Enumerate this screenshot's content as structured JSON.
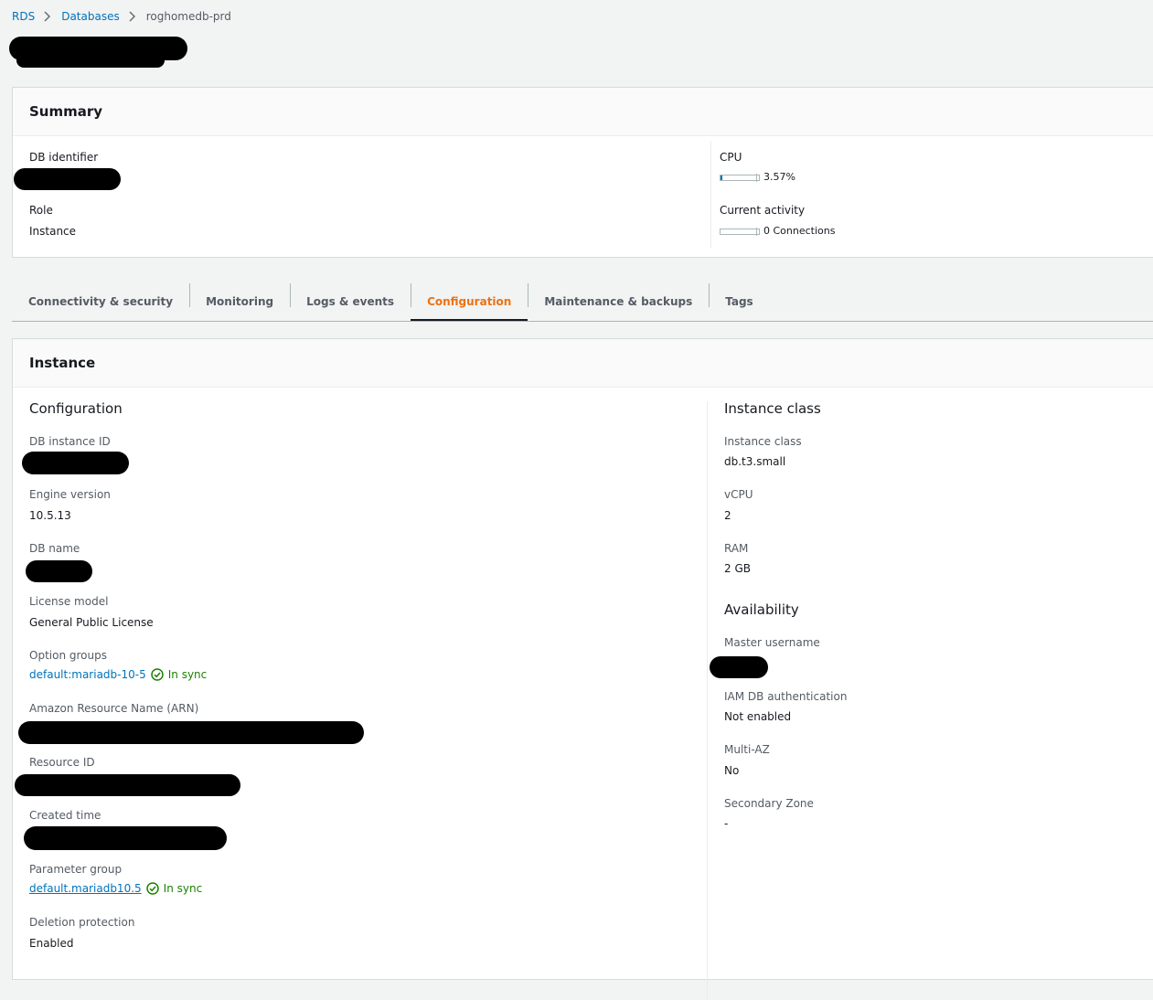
{
  "breadcrumb": {
    "items": [
      {
        "label": "RDS"
      },
      {
        "label": "Databases"
      }
    ],
    "current": "roghomedb-prd"
  },
  "summary": {
    "title": "Summary",
    "db_identifier_label": "DB identifier",
    "role_label": "Role",
    "role_value": "Instance",
    "cpu_label": "CPU",
    "cpu_value": "3.57%",
    "cpu_fraction": 0.0357,
    "activity_label": "Current activity",
    "activity_value": "0 Connections",
    "activity_fraction": 0
  },
  "tabs": [
    {
      "label": "Connectivity & security",
      "active": false
    },
    {
      "label": "Monitoring",
      "active": false
    },
    {
      "label": "Logs & events",
      "active": false
    },
    {
      "label": "Configuration",
      "active": true
    },
    {
      "label": "Maintenance & backups",
      "active": false
    },
    {
      "label": "Tags",
      "active": false
    }
  ],
  "instance": {
    "title": "Instance",
    "configuration": {
      "title": "Configuration",
      "db_instance_id_label": "DB instance ID",
      "engine_version_label": "Engine version",
      "engine_version_value": "10.5.13",
      "db_name_label": "DB name",
      "license_model_label": "License model",
      "license_model_value": "General Public License",
      "option_groups_label": "Option groups",
      "option_groups_value": "default:mariadb-10-5",
      "option_groups_status": "In sync",
      "arn_label": "Amazon Resource Name (ARN)",
      "resource_id_label": "Resource ID",
      "created_time_label": "Created time",
      "parameter_group_label": "Parameter group",
      "parameter_group_value": "default.mariadb10.5",
      "parameter_group_status": "In sync",
      "deletion_protection_label": "Deletion protection",
      "deletion_protection_value": "Enabled"
    },
    "instance_class": {
      "title": "Instance class",
      "class_label": "Instance class",
      "class_value": "db.t3.small",
      "vcpu_label": "vCPU",
      "vcpu_value": "2",
      "ram_label": "RAM",
      "ram_value": "2 GB"
    },
    "availability": {
      "title": "Availability",
      "master_username_label": "Master username",
      "iam_label": "IAM DB authentication",
      "iam_value": "Not enabled",
      "multi_az_label": "Multi-AZ",
      "multi_az_value": "No",
      "secondary_zone_label": "Secondary Zone",
      "secondary_zone_value": "-"
    }
  },
  "colors": {
    "link": "#0073bb",
    "active_tab": "#ec7211",
    "success": "#1d8102",
    "redaction": "#000000"
  },
  "icons": [
    "chevron-right-icon",
    "status-success-icon"
  ]
}
